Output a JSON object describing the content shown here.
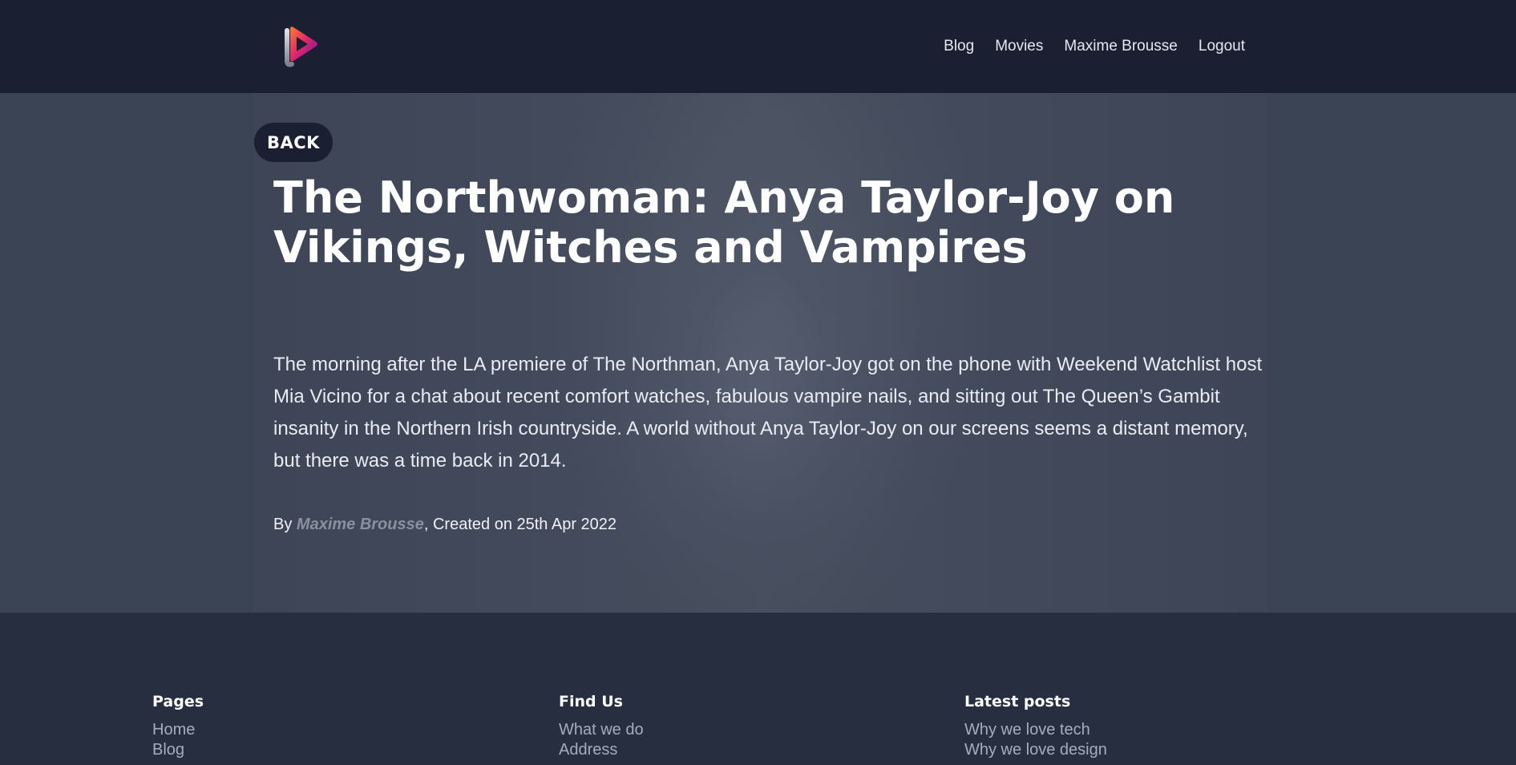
{
  "header": {
    "logo_icon": "play-logo-icon",
    "nav": [
      "Blog",
      "Movies",
      "Maxime Brousse",
      "Logout"
    ]
  },
  "article": {
    "back_label": "BACK",
    "title": "The Northwoman: Anya Taylor-Joy on Vikings, Witches and Vampires",
    "excerpt": "The morning after the LA premiere of The Northman, Anya Taylor-Joy got on the phone with Weekend Watchlist host Mia Vicino for a chat about recent comfort watches, fabulous vampire nails, and sitting out The Queen’s Gambit insanity in the Northern Irish countryside. A world without Anya Taylor-Joy on our screens seems a distant memory, but there was a time back in 2014.",
    "by_prefix": "By ",
    "author": "Maxime Brousse",
    "created": ", Created on 25th Apr 2022"
  },
  "footer": {
    "pages": {
      "heading": "Pages",
      "links": [
        "Home",
        "Blog"
      ]
    },
    "find_us": {
      "heading": "Find Us",
      "links": [
        "What we do",
        "Address"
      ]
    },
    "latest": {
      "heading": "Latest posts",
      "links": [
        "Why we love tech",
        "Why we love design"
      ]
    }
  },
  "colors": {
    "header_bg": "#1a2031",
    "hero_bg": "#3b4454",
    "footer_bg": "#272e3f",
    "logo_gradient": [
      "#ff7a2f",
      "#e0246e",
      "#5b1ea8"
    ]
  }
}
